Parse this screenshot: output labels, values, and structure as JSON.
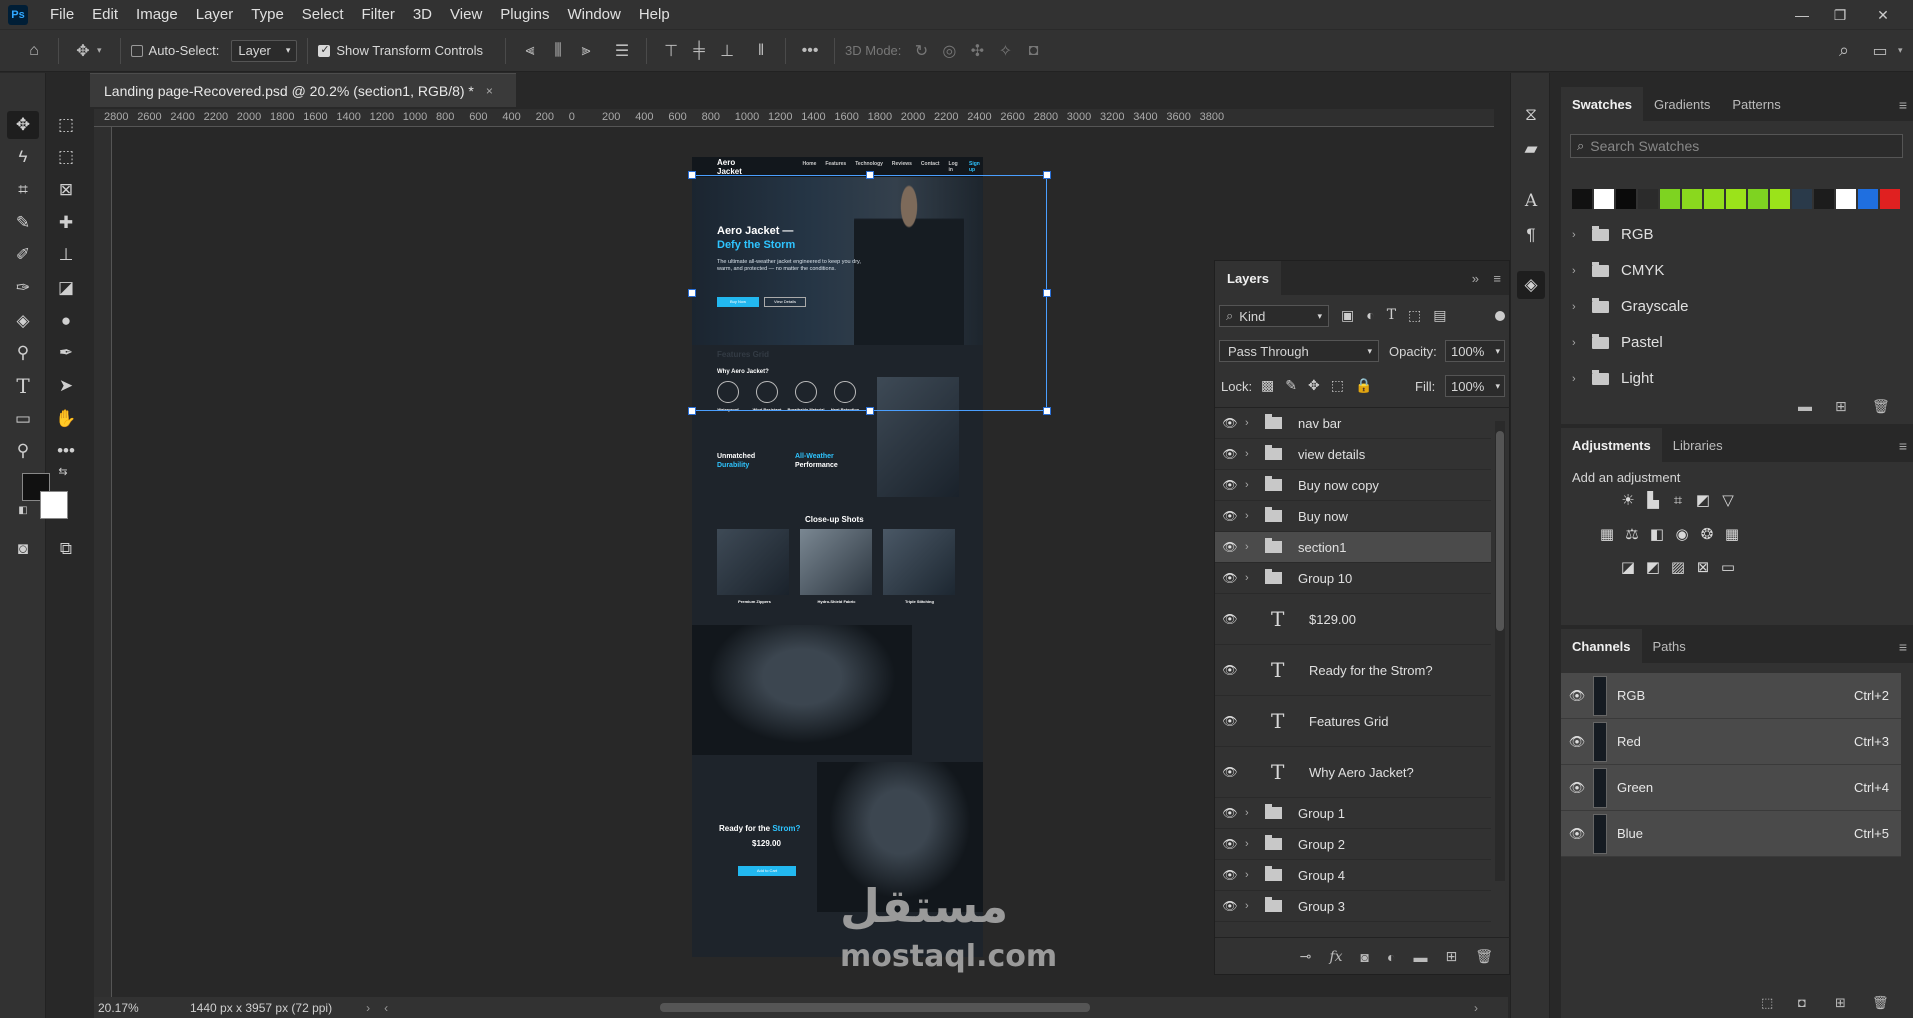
{
  "menubar": {
    "logo": "Ps",
    "items": [
      "File",
      "Edit",
      "Image",
      "Layer",
      "Type",
      "Select",
      "Filter",
      "3D",
      "View",
      "Plugins",
      "Window",
      "Help"
    ]
  },
  "options": {
    "auto_select_label": "Auto-Select:",
    "auto_select_value": "Layer",
    "show_transform_label": "Show Transform Controls",
    "mode_3d_label": "3D Mode:"
  },
  "document": {
    "tab_title": "Landing page-Recovered.psd @ 20.2% (section1, RGB/8) *",
    "close": "×"
  },
  "ruler": {
    "ticks": [
      "2800",
      "2600",
      "2400",
      "2200",
      "2000",
      "1800",
      "1600",
      "1400",
      "1200",
      "1000",
      "800",
      "600",
      "400",
      "200",
      "0",
      "200",
      "400",
      "600",
      "800",
      "1000",
      "1200",
      "1400",
      "1600",
      "1800",
      "2000",
      "2200",
      "2400",
      "2600",
      "2800",
      "3000",
      "3200",
      "3400",
      "3600",
      "3800"
    ]
  },
  "status": {
    "zoom": "20.17%",
    "doc_size": "1440 px x 3957 px (72 ppi)"
  },
  "artboard": {
    "brand": "Aero Jacket",
    "nav_links": [
      "Home",
      "Features",
      "Technology",
      "Reviews",
      "Contact",
      "Log in",
      "Sign up"
    ],
    "hero_title": "Aero Jacket —",
    "hero_title_accent": "Defy the Storm",
    "hero_sub": "The ultimate all-weather jacket engineered to keep you dry, warm, and protected — no matter the conditions.",
    "btn_buy": "Buy Now",
    "btn_details": "View Details",
    "features_label": "Features Grid",
    "why_label": "Why Aero Jacket?",
    "features": [
      "Waterproof",
      "Wind Resistant",
      "Breathable Material",
      "Heat Retention"
    ],
    "durability_1": "Unmatched",
    "durability_2": "Durability",
    "perf_1": "All-Weather",
    "perf_2": "Performance",
    "closeup_title": "Close-up Shots",
    "closeups": [
      "Premium Zippers",
      "Hydro-Shield Fabric",
      "Triple Stitching"
    ],
    "ready_1": "Ready for the ",
    "ready_2": "Strom?",
    "price": "$129.00",
    "add_cart": "Add to Cart"
  },
  "swatches_panel": {
    "tabs": [
      "Swatches",
      "Gradients",
      "Patterns"
    ],
    "search_placeholder": "Search Swatches",
    "colors": [
      "#111111",
      "#ffffff",
      "#0a0a0a",
      "#2b2b2b",
      "#7ed321",
      "#8ad81e",
      "#93de1c",
      "#9be31a",
      "#7ed321",
      "#9be31a",
      "#2a3a4a",
      "#1c1c1c",
      "#ffffff",
      "#1f6fe0",
      "#e02020"
    ],
    "groups": [
      "RGB",
      "CMYK",
      "Grayscale",
      "Pastel",
      "Light"
    ]
  },
  "adjustments_panel": {
    "tabs": [
      "Adjustments",
      "Libraries"
    ],
    "add_label": "Add an adjustment"
  },
  "channels_panel": {
    "tabs": [
      "Channels",
      "Paths"
    ],
    "rows": [
      {
        "name": "RGB",
        "shortcut": "Ctrl+2"
      },
      {
        "name": "Red",
        "shortcut": "Ctrl+3"
      },
      {
        "name": "Green",
        "shortcut": "Ctrl+4"
      },
      {
        "name": "Blue",
        "shortcut": "Ctrl+5"
      }
    ]
  },
  "layers_panel": {
    "title": "Layers",
    "kind": "Kind",
    "blend_mode": "Pass Through",
    "opacity_label": "Opacity:",
    "opacity": "100%",
    "lock_label": "Lock:",
    "fill_label": "Fill:",
    "fill": "100%",
    "layers": [
      {
        "name": "nav bar",
        "type": "group"
      },
      {
        "name": "view details",
        "type": "group"
      },
      {
        "name": "Buy now copy",
        "type": "group"
      },
      {
        "name": "Buy now",
        "type": "group"
      },
      {
        "name": "section1",
        "type": "group",
        "selected": true
      },
      {
        "name": "Group 10",
        "type": "group"
      },
      {
        "name": "$129.00",
        "type": "text"
      },
      {
        "name": "Ready for the Strom?",
        "type": "text"
      },
      {
        "name": "Features Grid",
        "type": "text"
      },
      {
        "name": "Why Aero Jacket?",
        "type": "text"
      },
      {
        "name": "Group 1",
        "type": "group"
      },
      {
        "name": "Group 2",
        "type": "group"
      },
      {
        "name": "Group 4",
        "type": "group"
      },
      {
        "name": "Group 3",
        "type": "group"
      }
    ]
  },
  "watermark": {
    "arabic": "مستقل",
    "latin": "mostaql.com"
  }
}
